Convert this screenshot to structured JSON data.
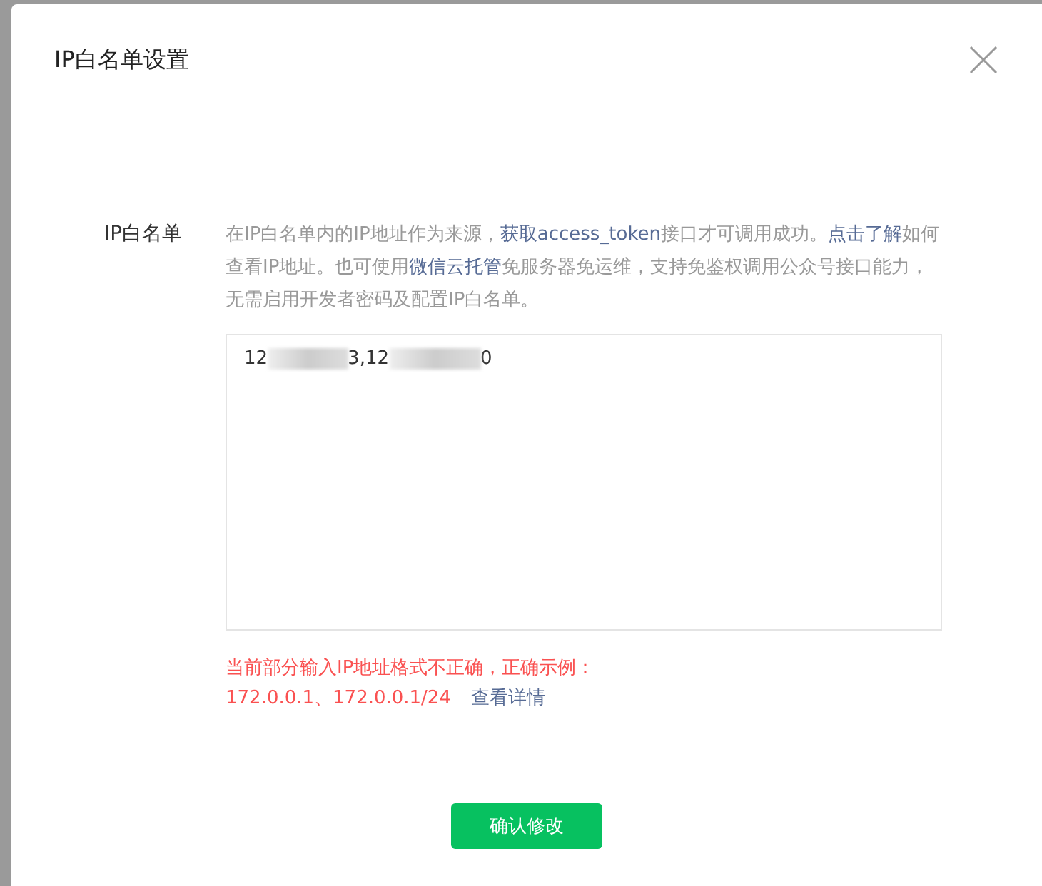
{
  "dialog": {
    "title": "IP白名单设置",
    "field_label": "IP白名单",
    "description": [
      {
        "kind": "text",
        "text": "在IP白名单内的IP地址作为来源，"
      },
      {
        "kind": "link",
        "text": "获取access_token"
      },
      {
        "kind": "text",
        "text": "接口才可调用成功。"
      },
      {
        "kind": "link",
        "text": "点击了解"
      },
      {
        "kind": "text",
        "text": "如何查看IP地址。也可使用"
      },
      {
        "kind": "link",
        "text": "微信云托管"
      },
      {
        "kind": "text",
        "text": "免服务器免运维，支持免鉴权调用公众号接口能力，无需启用开发者密码及配置IP白名单。"
      }
    ],
    "ip_field": {
      "value_parts": [
        "12",
        "3,12",
        "0"
      ]
    },
    "error": {
      "message": "当前部分输入IP地址格式不正确，正确示例：",
      "example": "172.0.0.1、172.0.0.1/24",
      "link": "查看详情"
    },
    "confirm_button": "确认修改"
  }
}
